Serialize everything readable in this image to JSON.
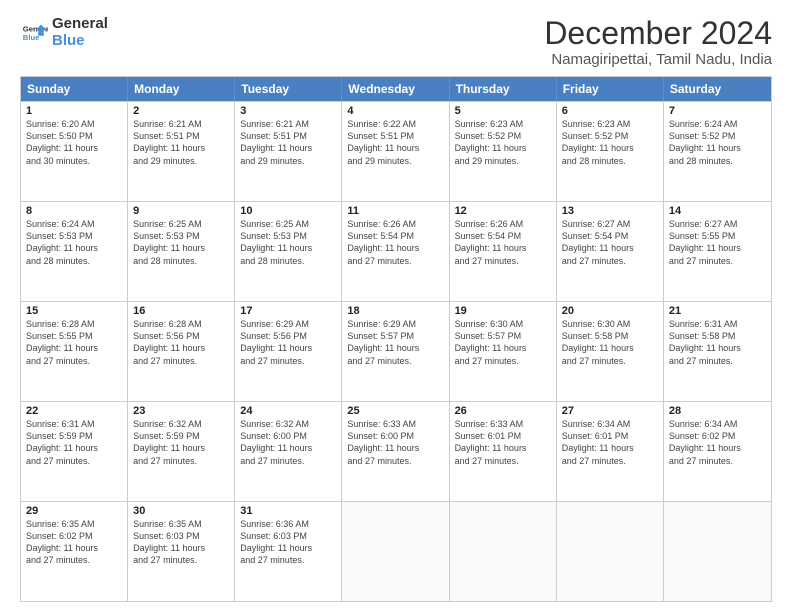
{
  "header": {
    "logo_line1": "General",
    "logo_line2": "Blue",
    "title": "December 2024",
    "subtitle": "Namagiripettai, Tamil Nadu, India"
  },
  "calendar": {
    "days": [
      "Sunday",
      "Monday",
      "Tuesday",
      "Wednesday",
      "Thursday",
      "Friday",
      "Saturday"
    ],
    "rows": [
      [
        {
          "day": "1",
          "info": "Sunrise: 6:20 AM\nSunset: 5:50 PM\nDaylight: 11 hours\nand 30 minutes."
        },
        {
          "day": "2",
          "info": "Sunrise: 6:21 AM\nSunset: 5:51 PM\nDaylight: 11 hours\nand 29 minutes."
        },
        {
          "day": "3",
          "info": "Sunrise: 6:21 AM\nSunset: 5:51 PM\nDaylight: 11 hours\nand 29 minutes."
        },
        {
          "day": "4",
          "info": "Sunrise: 6:22 AM\nSunset: 5:51 PM\nDaylight: 11 hours\nand 29 minutes."
        },
        {
          "day": "5",
          "info": "Sunrise: 6:23 AM\nSunset: 5:52 PM\nDaylight: 11 hours\nand 29 minutes."
        },
        {
          "day": "6",
          "info": "Sunrise: 6:23 AM\nSunset: 5:52 PM\nDaylight: 11 hours\nand 28 minutes."
        },
        {
          "day": "7",
          "info": "Sunrise: 6:24 AM\nSunset: 5:52 PM\nDaylight: 11 hours\nand 28 minutes."
        }
      ],
      [
        {
          "day": "8",
          "info": "Sunrise: 6:24 AM\nSunset: 5:53 PM\nDaylight: 11 hours\nand 28 minutes."
        },
        {
          "day": "9",
          "info": "Sunrise: 6:25 AM\nSunset: 5:53 PM\nDaylight: 11 hours\nand 28 minutes."
        },
        {
          "day": "10",
          "info": "Sunrise: 6:25 AM\nSunset: 5:53 PM\nDaylight: 11 hours\nand 28 minutes."
        },
        {
          "day": "11",
          "info": "Sunrise: 6:26 AM\nSunset: 5:54 PM\nDaylight: 11 hours\nand 27 minutes."
        },
        {
          "day": "12",
          "info": "Sunrise: 6:26 AM\nSunset: 5:54 PM\nDaylight: 11 hours\nand 27 minutes."
        },
        {
          "day": "13",
          "info": "Sunrise: 6:27 AM\nSunset: 5:54 PM\nDaylight: 11 hours\nand 27 minutes."
        },
        {
          "day": "14",
          "info": "Sunrise: 6:27 AM\nSunset: 5:55 PM\nDaylight: 11 hours\nand 27 minutes."
        }
      ],
      [
        {
          "day": "15",
          "info": "Sunrise: 6:28 AM\nSunset: 5:55 PM\nDaylight: 11 hours\nand 27 minutes."
        },
        {
          "day": "16",
          "info": "Sunrise: 6:28 AM\nSunset: 5:56 PM\nDaylight: 11 hours\nand 27 minutes."
        },
        {
          "day": "17",
          "info": "Sunrise: 6:29 AM\nSunset: 5:56 PM\nDaylight: 11 hours\nand 27 minutes."
        },
        {
          "day": "18",
          "info": "Sunrise: 6:29 AM\nSunset: 5:57 PM\nDaylight: 11 hours\nand 27 minutes."
        },
        {
          "day": "19",
          "info": "Sunrise: 6:30 AM\nSunset: 5:57 PM\nDaylight: 11 hours\nand 27 minutes."
        },
        {
          "day": "20",
          "info": "Sunrise: 6:30 AM\nSunset: 5:58 PM\nDaylight: 11 hours\nand 27 minutes."
        },
        {
          "day": "21",
          "info": "Sunrise: 6:31 AM\nSunset: 5:58 PM\nDaylight: 11 hours\nand 27 minutes."
        }
      ],
      [
        {
          "day": "22",
          "info": "Sunrise: 6:31 AM\nSunset: 5:59 PM\nDaylight: 11 hours\nand 27 minutes."
        },
        {
          "day": "23",
          "info": "Sunrise: 6:32 AM\nSunset: 5:59 PM\nDaylight: 11 hours\nand 27 minutes."
        },
        {
          "day": "24",
          "info": "Sunrise: 6:32 AM\nSunset: 6:00 PM\nDaylight: 11 hours\nand 27 minutes."
        },
        {
          "day": "25",
          "info": "Sunrise: 6:33 AM\nSunset: 6:00 PM\nDaylight: 11 hours\nand 27 minutes."
        },
        {
          "day": "26",
          "info": "Sunrise: 6:33 AM\nSunset: 6:01 PM\nDaylight: 11 hours\nand 27 minutes."
        },
        {
          "day": "27",
          "info": "Sunrise: 6:34 AM\nSunset: 6:01 PM\nDaylight: 11 hours\nand 27 minutes."
        },
        {
          "day": "28",
          "info": "Sunrise: 6:34 AM\nSunset: 6:02 PM\nDaylight: 11 hours\nand 27 minutes."
        }
      ],
      [
        {
          "day": "29",
          "info": "Sunrise: 6:35 AM\nSunset: 6:02 PM\nDaylight: 11 hours\nand 27 minutes."
        },
        {
          "day": "30",
          "info": "Sunrise: 6:35 AM\nSunset: 6:03 PM\nDaylight: 11 hours\nand 27 minutes."
        },
        {
          "day": "31",
          "info": "Sunrise: 6:36 AM\nSunset: 6:03 PM\nDaylight: 11 hours\nand 27 minutes."
        },
        {
          "day": "",
          "info": ""
        },
        {
          "day": "",
          "info": ""
        },
        {
          "day": "",
          "info": ""
        },
        {
          "day": "",
          "info": ""
        }
      ]
    ]
  }
}
